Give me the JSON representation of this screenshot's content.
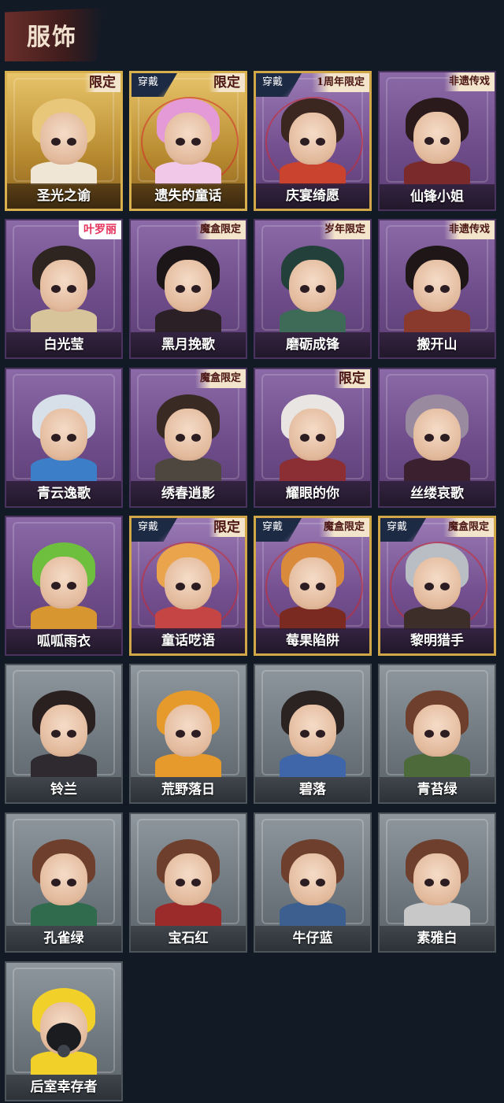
{
  "header": {
    "title": "服饰"
  },
  "items": [
    {
      "name": "圣光之谕",
      "tag": "限定",
      "worn": false,
      "style": "gold",
      "hair": "#e8c77a",
      "outfit": "#f0e6d6"
    },
    {
      "name": "遗失的童话",
      "tag": "限定",
      "worn": true,
      "worn_label": "穿戴",
      "style": "gold",
      "hair": "#e39ad6",
      "outfit": "#f2c8e8"
    },
    {
      "name": "庆宴绮愿",
      "tag": "1周年限定",
      "worn": true,
      "worn_label": "穿戴",
      "style": "purple-gold",
      "hair": "#3b2620",
      "outfit": "#c9432f"
    },
    {
      "name": "仙锋小姐",
      "tag": "非遗传戏",
      "worn": false,
      "style": "purple",
      "hair": "#2a1a1c",
      "outfit": "#7a2a2a"
    },
    {
      "name": "白光莹",
      "tag": "叶罗丽",
      "worn": false,
      "style": "purple",
      "hair": "#2e2420",
      "outfit": "#d8c49a"
    },
    {
      "name": "黑月挽歌",
      "tag": "魔盒限定",
      "worn": false,
      "style": "purple",
      "hair": "#1d1619",
      "outfit": "#2a2026"
    },
    {
      "name": "磨砺成锋",
      "tag": "岁年限定",
      "worn": false,
      "style": "purple",
      "hair": "#23403a",
      "outfit": "#3d6b57"
    },
    {
      "name": "搬开山",
      "tag": "非遗传戏",
      "worn": false,
      "style": "purple",
      "hair": "#1f1618",
      "outfit": "#8a3a2c"
    },
    {
      "name": "青云逸歌",
      "tag": "",
      "worn": false,
      "style": "purple",
      "hair": "#d7dfe8",
      "outfit": "#3c7fc8"
    },
    {
      "name": "绣春逍影",
      "tag": "魔盒限定",
      "worn": false,
      "style": "purple",
      "hair": "#3a2a24",
      "outfit": "#4e4740"
    },
    {
      "name": "耀眼的你",
      "tag": "限定",
      "worn": false,
      "style": "purple",
      "hair": "#e9e5e2",
      "outfit": "#8c2f35"
    },
    {
      "name": "丝缕哀歌",
      "tag": "",
      "worn": false,
      "style": "purple",
      "hair": "#9a8aa0",
      "outfit": "#3b2030"
    },
    {
      "name": "呱呱雨衣",
      "tag": "",
      "worn": false,
      "style": "purple",
      "hair": "#6fbf3f",
      "outfit": "#d89630"
    },
    {
      "name": "童话呓语",
      "tag": "限定",
      "worn": true,
      "worn_label": "穿戴",
      "style": "purple-gold",
      "hair": "#e9a44c",
      "outfit": "#c54545"
    },
    {
      "name": "莓果陷阱",
      "tag": "魔盒限定",
      "worn": true,
      "worn_label": "穿戴",
      "style": "purple-gold",
      "hair": "#d98a3a",
      "outfit": "#7a2a20"
    },
    {
      "name": "黎明猎手",
      "tag": "魔盒限定",
      "worn": true,
      "worn_label": "穿戴",
      "style": "purple-gold",
      "hair": "#b9bec4",
      "outfit": "#3d2e2a"
    },
    {
      "name": "铃兰",
      "tag": "",
      "worn": false,
      "style": "grey",
      "hair": "#2a2020",
      "outfit": "#2e2a30"
    },
    {
      "name": "荒野落日",
      "tag": "",
      "worn": false,
      "style": "grey",
      "hair": "#e79a2c",
      "outfit": "#e79a2c"
    },
    {
      "name": "碧落",
      "tag": "",
      "worn": false,
      "style": "grey",
      "hair": "#2b2222",
      "outfit": "#3f66a8"
    },
    {
      "name": "青苔绿",
      "tag": "",
      "worn": false,
      "style": "grey",
      "hair": "#6d3f2c",
      "outfit": "#4d6a3a"
    },
    {
      "name": "孔雀绿",
      "tag": "",
      "worn": false,
      "style": "grey",
      "hair": "#6d3f2c",
      "outfit": "#2f6b4c"
    },
    {
      "name": "宝石红",
      "tag": "",
      "worn": false,
      "style": "grey",
      "hair": "#6d3f2c",
      "outfit": "#9b2a2a"
    },
    {
      "name": "牛仔蓝",
      "tag": "",
      "worn": false,
      "style": "grey",
      "hair": "#6d3f2c",
      "outfit": "#3c5f8f"
    },
    {
      "name": "素雅白",
      "tag": "",
      "worn": false,
      "style": "grey",
      "hair": "#6d3f2c",
      "outfit": "#c8c8c8"
    },
    {
      "name": "后室幸存者",
      "tag": "",
      "worn": false,
      "style": "grey",
      "hair": "#f2d02a",
      "outfit": "#f2d02a",
      "mask": true
    }
  ]
}
